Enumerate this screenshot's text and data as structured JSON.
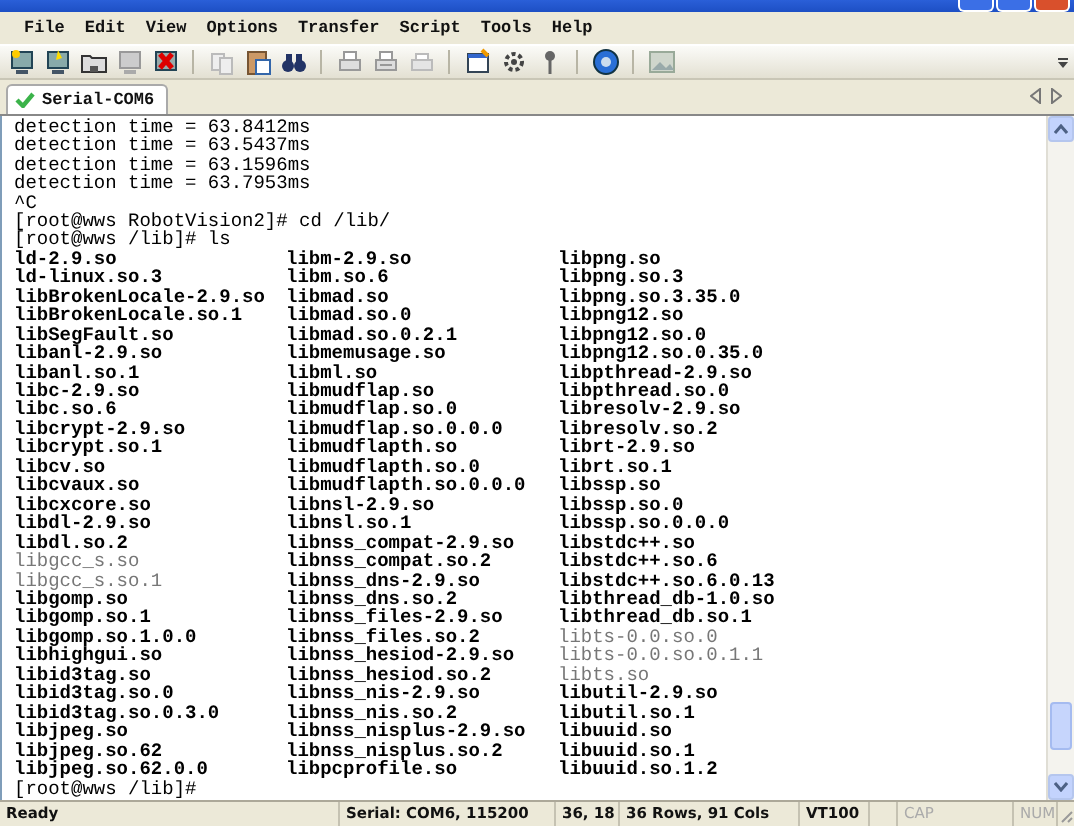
{
  "menu": [
    "File",
    "Edit",
    "View",
    "Options",
    "Transfer",
    "Script",
    "Tools",
    "Help"
  ],
  "tabs": [
    {
      "label": "Serial-COM6",
      "selected": true
    }
  ],
  "terminal": {
    "lines": [
      "detection time = 63.8412ms",
      "detection time = 63.5437ms",
      "detection time = 63.1596ms",
      "detection time = 63.7953ms",
      "^C",
      "[root@wws RobotVision2]# cd /lib/",
      "[root@wws /lib]# ls"
    ],
    "listing": [
      [
        {
          "name": "ld-2.9.so",
          "dim": false
        },
        {
          "name": "ld-linux.so.3",
          "dim": false
        },
        {
          "name": "libBrokenLocale-2.9.so",
          "dim": false
        },
        {
          "name": "libBrokenLocale.so.1",
          "dim": false
        },
        {
          "name": "libSegFault.so",
          "dim": false
        },
        {
          "name": "libanl-2.9.so",
          "dim": false
        },
        {
          "name": "libanl.so.1",
          "dim": false
        },
        {
          "name": "libc-2.9.so",
          "dim": false
        },
        {
          "name": "libc.so.6",
          "dim": false
        },
        {
          "name": "libcrypt-2.9.so",
          "dim": false
        },
        {
          "name": "libcrypt.so.1",
          "dim": false
        },
        {
          "name": "libcv.so",
          "dim": false
        },
        {
          "name": "libcvaux.so",
          "dim": false
        },
        {
          "name": "libcxcore.so",
          "dim": false
        },
        {
          "name": "libdl-2.9.so",
          "dim": false
        },
        {
          "name": "libdl.so.2",
          "dim": false
        },
        {
          "name": "libgcc_s.so",
          "dim": true
        },
        {
          "name": "libgcc_s.so.1",
          "dim": true
        },
        {
          "name": "libgomp.so",
          "dim": false
        },
        {
          "name": "libgomp.so.1",
          "dim": false
        },
        {
          "name": "libgomp.so.1.0.0",
          "dim": false
        },
        {
          "name": "libhighgui.so",
          "dim": false
        },
        {
          "name": "libid3tag.so",
          "dim": false
        },
        {
          "name": "libid3tag.so.0",
          "dim": false
        },
        {
          "name": "libid3tag.so.0.3.0",
          "dim": false
        },
        {
          "name": "libjpeg.so",
          "dim": false
        },
        {
          "name": "libjpeg.so.62",
          "dim": false
        },
        {
          "name": "libjpeg.so.62.0.0",
          "dim": false
        }
      ],
      [
        {
          "name": "libm-2.9.so",
          "dim": false
        },
        {
          "name": "libm.so.6",
          "dim": false
        },
        {
          "name": "libmad.so",
          "dim": false
        },
        {
          "name": "libmad.so.0",
          "dim": false
        },
        {
          "name": "libmad.so.0.2.1",
          "dim": false
        },
        {
          "name": "libmemusage.so",
          "dim": false
        },
        {
          "name": "libml.so",
          "dim": false
        },
        {
          "name": "libmudflap.so",
          "dim": false
        },
        {
          "name": "libmudflap.so.0",
          "dim": false
        },
        {
          "name": "libmudflap.so.0.0.0",
          "dim": false
        },
        {
          "name": "libmudflapth.so",
          "dim": false
        },
        {
          "name": "libmudflapth.so.0",
          "dim": false
        },
        {
          "name": "libmudflapth.so.0.0.0",
          "dim": false
        },
        {
          "name": "libnsl-2.9.so",
          "dim": false
        },
        {
          "name": "libnsl.so.1",
          "dim": false
        },
        {
          "name": "libnss_compat-2.9.so",
          "dim": false
        },
        {
          "name": "libnss_compat.so.2",
          "dim": false
        },
        {
          "name": "libnss_dns-2.9.so",
          "dim": false
        },
        {
          "name": "libnss_dns.so.2",
          "dim": false
        },
        {
          "name": "libnss_files-2.9.so",
          "dim": false
        },
        {
          "name": "libnss_files.so.2",
          "dim": false
        },
        {
          "name": "libnss_hesiod-2.9.so",
          "dim": false
        },
        {
          "name": "libnss_hesiod.so.2",
          "dim": false
        },
        {
          "name": "libnss_nis-2.9.so",
          "dim": false
        },
        {
          "name": "libnss_nis.so.2",
          "dim": false
        },
        {
          "name": "libnss_nisplus-2.9.so",
          "dim": false
        },
        {
          "name": "libnss_nisplus.so.2",
          "dim": false
        },
        {
          "name": "libpcprofile.so",
          "dim": false
        }
      ],
      [
        {
          "name": "libpng.so",
          "dim": false
        },
        {
          "name": "libpng.so.3",
          "dim": false
        },
        {
          "name": "libpng.so.3.35.0",
          "dim": false
        },
        {
          "name": "libpng12.so",
          "dim": false
        },
        {
          "name": "libpng12.so.0",
          "dim": false
        },
        {
          "name": "libpng12.so.0.35.0",
          "dim": false
        },
        {
          "name": "libpthread-2.9.so",
          "dim": false
        },
        {
          "name": "libpthread.so.0",
          "dim": false
        },
        {
          "name": "libresolv-2.9.so",
          "dim": false
        },
        {
          "name": "libresolv.so.2",
          "dim": false
        },
        {
          "name": "librt-2.9.so",
          "dim": false
        },
        {
          "name": "librt.so.1",
          "dim": false
        },
        {
          "name": "libssp.so",
          "dim": false
        },
        {
          "name": "libssp.so.0",
          "dim": false
        },
        {
          "name": "libssp.so.0.0.0",
          "dim": false
        },
        {
          "name": "libstdc++.so",
          "dim": false
        },
        {
          "name": "libstdc++.so.6",
          "dim": false
        },
        {
          "name": "libstdc++.so.6.0.13",
          "dim": false
        },
        {
          "name": "libthread_db-1.0.so",
          "dim": false
        },
        {
          "name": "libthread_db.so.1",
          "dim": false
        },
        {
          "name": "libts-0.0.so.0",
          "dim": true
        },
        {
          "name": "libts-0.0.so.0.1.1",
          "dim": true
        },
        {
          "name": "libts.so",
          "dim": true
        },
        {
          "name": "libutil-2.9.so",
          "dim": false
        },
        {
          "name": "libutil.so.1",
          "dim": false
        },
        {
          "name": "libuuid.so",
          "dim": false
        },
        {
          "name": "libuuid.so.1",
          "dim": false
        },
        {
          "name": "libuuid.so.1.2",
          "dim": false
        }
      ]
    ],
    "prompt": "[root@wws /lib]#"
  },
  "status_bar": [
    {
      "text": "Ready",
      "disabled": false
    },
    {
      "text": "Serial: COM6, 115200",
      "disabled": false
    },
    {
      "text": "36, 18",
      "disabled": false
    },
    {
      "text": "36 Rows, 91 Cols",
      "disabled": false
    },
    {
      "text": "VT100",
      "disabled": false
    },
    {
      "text": "CAP",
      "disabled": true
    },
    {
      "text": "NUM",
      "disabled": true
    }
  ]
}
